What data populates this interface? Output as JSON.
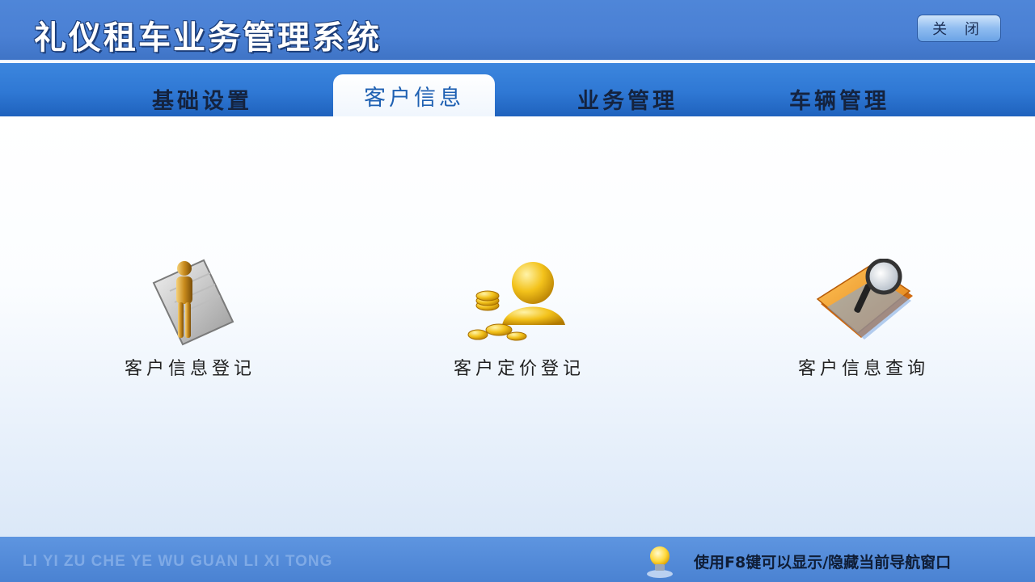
{
  "app": {
    "title": "礼仪租车业务管理系统",
    "close_label": "关 闭"
  },
  "tabs": [
    {
      "label": "基础设置",
      "active": false
    },
    {
      "label": "客户信息",
      "active": true
    },
    {
      "label": "业务管理",
      "active": false
    },
    {
      "label": "车辆管理",
      "active": false
    }
  ],
  "features": [
    {
      "label": "客户信息登记",
      "icon": "person-document-icon"
    },
    {
      "label": "客户定价登记",
      "icon": "gold-coins-user-icon"
    },
    {
      "label": "客户信息查询",
      "icon": "folder-magnifier-icon"
    }
  ],
  "status": {
    "pinyin": "LI YI ZU CHE YE WU GUAN LI XI TONG",
    "hint": "使用F8键可以显示/隐藏当前导航窗口",
    "hint_icon": "lightbulb-icon"
  },
  "colors": {
    "title_bar": "#4a80d4",
    "tab_bar": "#2f78d4",
    "active_tab_text": "#1e60b2",
    "status_bar": "#4a82d2"
  }
}
